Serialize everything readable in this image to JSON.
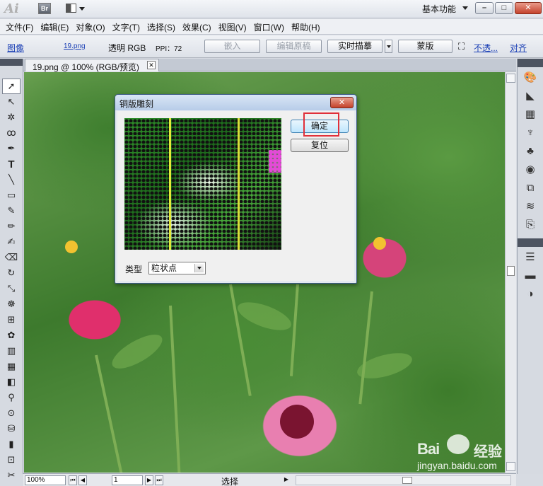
{
  "app": {
    "logo": "Ai",
    "bridge": "Br",
    "workspace": "基本功能"
  },
  "menu": [
    "文件(F)",
    "编辑(E)",
    "对象(O)",
    "文字(T)",
    "选择(S)",
    "效果(C)",
    "视图(V)",
    "窗口(W)",
    "帮助(H)"
  ],
  "control": {
    "image_label": "图像",
    "file_link": "19.png",
    "mode": "透明 RGB",
    "ppi": "PPI：72",
    "embed": "嵌入",
    "edit_original": "编辑原稿",
    "live_trace": "实时描摹",
    "mask": "蒙版",
    "opacity_link": "不透...",
    "align_link": "对齐"
  },
  "document": {
    "tab_title": "19.png @ 100% (RGB/预览)"
  },
  "dialog": {
    "title": "铜版雕刻",
    "ok": "确定",
    "reset": "复位",
    "type_label": "类型",
    "type_value": "粒状点"
  },
  "status": {
    "zoom": "100%",
    "page": "1",
    "tool": "选择"
  },
  "watermark": {
    "logo": "Bai",
    "cn": "经验",
    "url": "jingyan.baidu.com"
  }
}
